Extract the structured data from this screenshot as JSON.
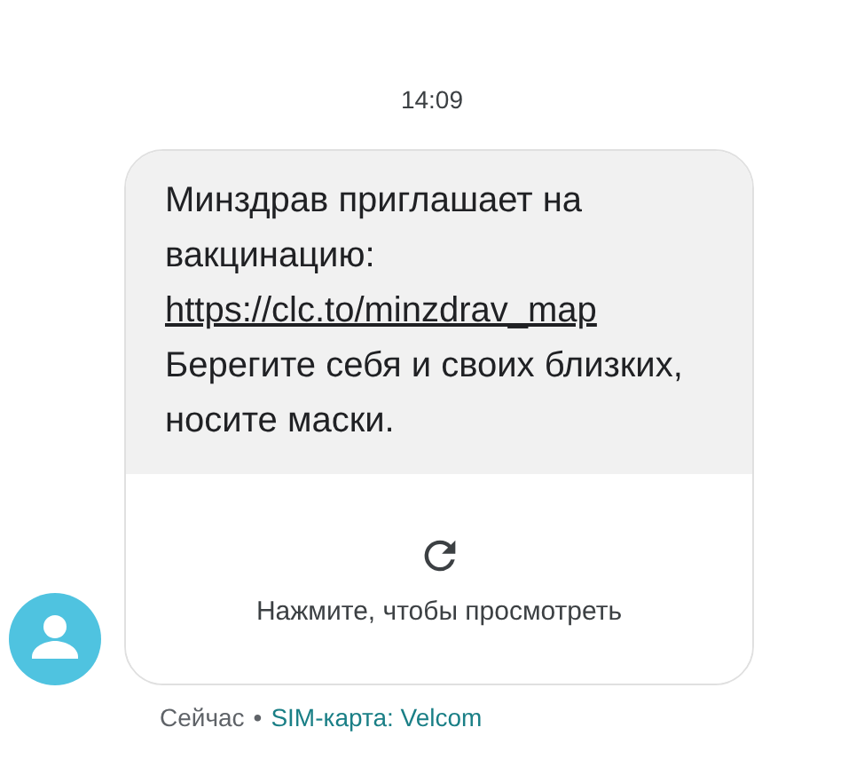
{
  "timestamp": "14:09",
  "message": {
    "text_before": "Минздрав приглашает на вакцинацию: ",
    "link": "https://clc.to/minzdrav_map",
    "text_after": " Берегите себя и своих близких, носите маски.",
    "preview_hint": "Нажмите, чтобы просмотреть"
  },
  "meta": {
    "time": "Сейчас",
    "separator": "•",
    "sim": "SIM-карта: Velcom"
  }
}
